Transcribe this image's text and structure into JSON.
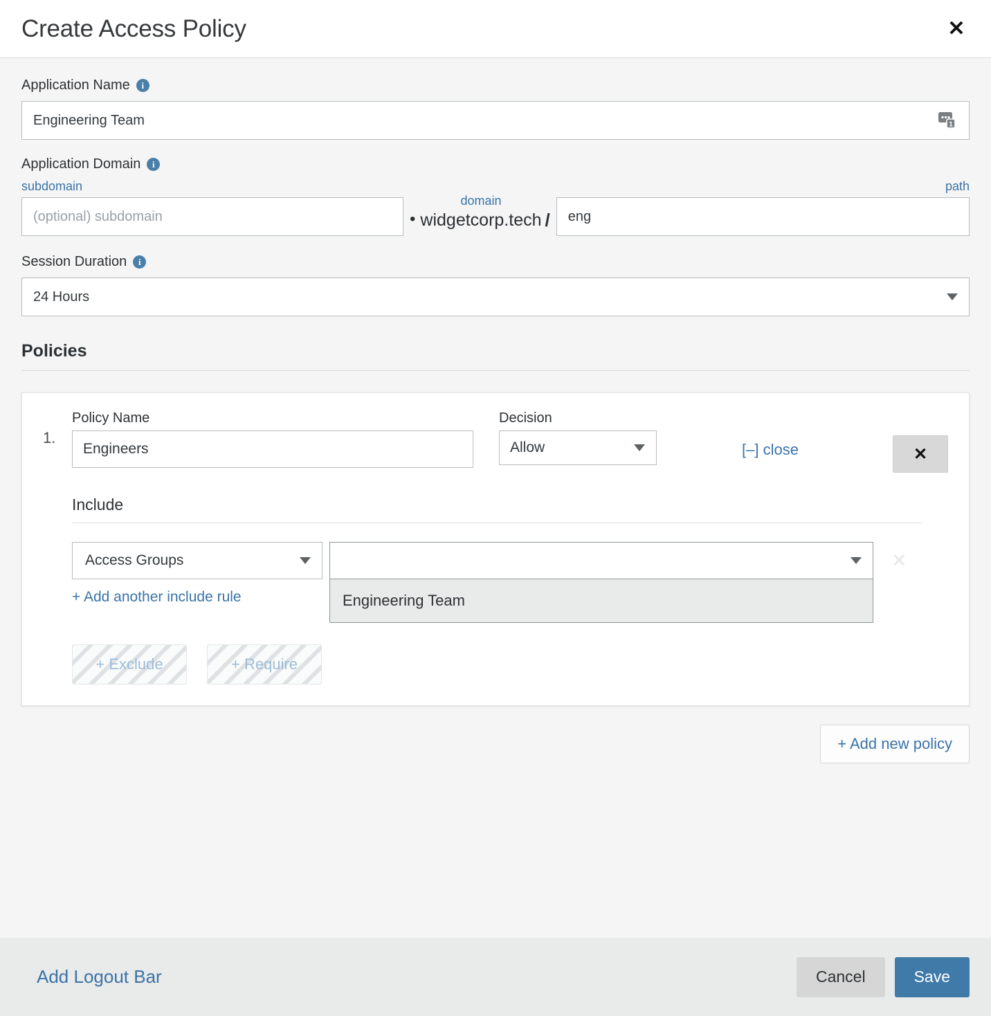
{
  "header": {
    "title": "Create Access Policy",
    "close_icon": "close-icon",
    "close_glyph": "✕"
  },
  "form": {
    "app_name": {
      "label": "Application Name",
      "info_icon": "info-icon",
      "info_glyph": "i",
      "value": "Engineering Team",
      "placeholder": "",
      "extension_icon": "password-manager-extension-icon"
    },
    "app_domain": {
      "label": "Application Domain",
      "info_icon": "info-icon",
      "info_glyph": "i",
      "subdomain_label": "subdomain",
      "subdomain_value": "",
      "subdomain_placeholder": "(optional) subdomain",
      "separator_dot": "•",
      "domain_label": "domain",
      "domain_text": "widgetcorp.tech",
      "slash": "/",
      "path_label": "path",
      "path_value": "eng",
      "path_placeholder": ""
    },
    "session_duration": {
      "label": "Session Duration",
      "info_icon": "info-icon",
      "info_glyph": "i",
      "value": "24 Hours",
      "options": [
        "24 Hours"
      ]
    }
  },
  "policies": {
    "section_title": "Policies",
    "items": [
      {
        "number": "1.",
        "policy_name_label": "Policy Name",
        "policy_name_value": "Engineers",
        "decision_label": "Decision",
        "decision_value": "Allow",
        "decision_options": [
          "Allow"
        ],
        "close_link": "[–] close",
        "remove_glyph": "✕",
        "include_label": "Include",
        "rule_type_value": "Access Groups",
        "rule_type_options": [
          "Access Groups"
        ],
        "rule_value_selected": "",
        "rule_value_options": [
          "Engineering Team"
        ],
        "clear_glyph": "✕",
        "add_include_link": "+ Add another include rule",
        "exclude_button": "+ Exclude",
        "require_button": "+ Require"
      }
    ],
    "add_policy_button": "+ Add new policy"
  },
  "footer": {
    "logout_link": "Add Logout Bar",
    "cancel_button": "Cancel",
    "save_button": "Save"
  },
  "colors": {
    "link_blue": "#3a73a8",
    "save_blue": "#3f7aa8",
    "info_blue": "#4a7fa8",
    "page_bg": "#f5f5f5",
    "footer_bg": "#e9eaea",
    "dropdown_bg": "#e9eaea",
    "border_grey": "#b6bbbf"
  }
}
